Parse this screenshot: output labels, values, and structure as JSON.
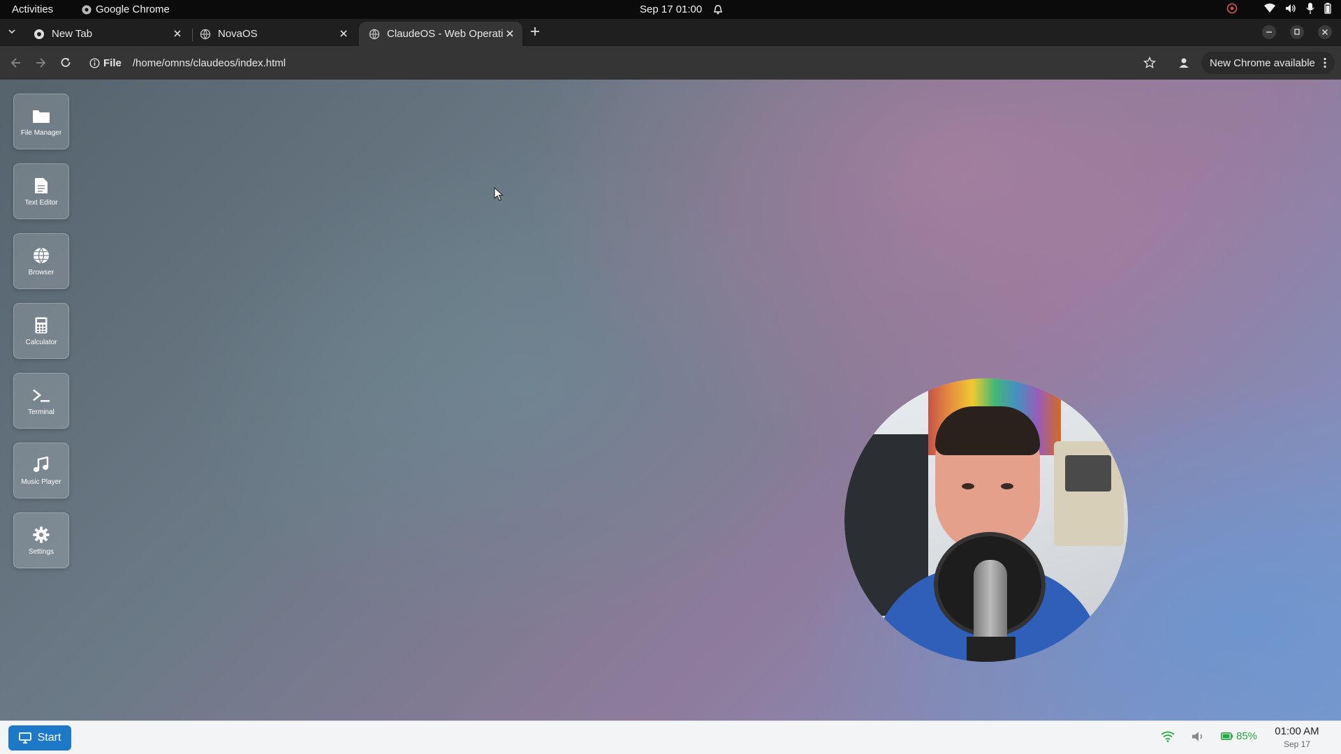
{
  "system_bar": {
    "activities": "Activities",
    "app_name": "Google Chrome",
    "datetime": "Sep 17  01:00"
  },
  "browser": {
    "tabs": [
      {
        "label": "New Tab",
        "active": false
      },
      {
        "label": "NovaOS",
        "active": false
      },
      {
        "label": "ClaudeOS - Web Operati",
        "active": true
      }
    ],
    "address": {
      "scheme_label": "File",
      "url": "/home/omns/claudeos/index.html"
    },
    "update_banner": "New Chrome available"
  },
  "desktop": {
    "apps": [
      {
        "label": "File Manager",
        "icon": "folder-icon"
      },
      {
        "label": "Text Editor",
        "icon": "document-icon"
      },
      {
        "label": "Browser",
        "icon": "globe-icon"
      },
      {
        "label": "Calculator",
        "icon": "calculator-icon"
      },
      {
        "label": "Terminal",
        "icon": "terminal-icon"
      },
      {
        "label": "Music Player",
        "icon": "music-icon"
      },
      {
        "label": "Settings",
        "icon": "gear-icon"
      }
    ]
  },
  "taskbar": {
    "start_label": "Start",
    "battery": "85%",
    "battery_color": "#2aa845",
    "time": "01:00 AM",
    "date": "Sep 17",
    "start_color": "#1e78c8"
  }
}
